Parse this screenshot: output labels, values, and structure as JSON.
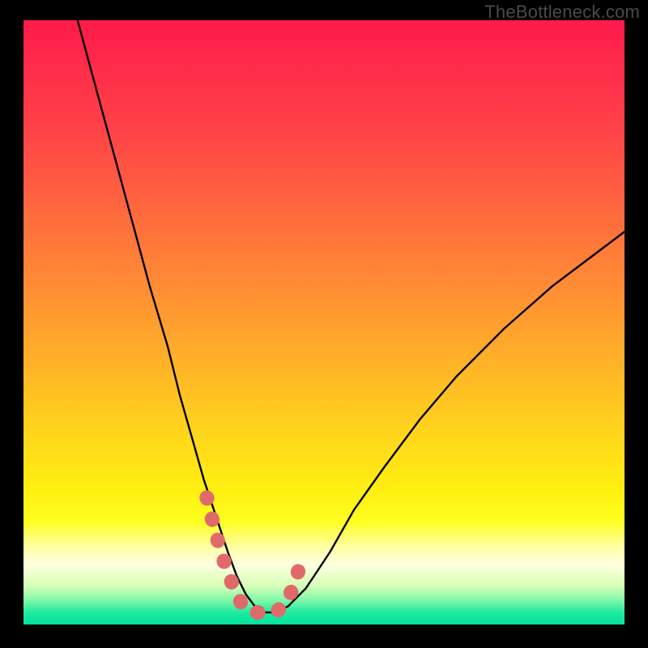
{
  "attribution": "TheBottleneck.com",
  "colors": {
    "background": "#000000",
    "curve": "#000000",
    "accent_dots": "#e06a6a",
    "gradient_top": "#ff1a4a",
    "gradient_bottom": "#00e29c"
  },
  "chart_data": {
    "type": "line",
    "title": "",
    "xlabel": "",
    "ylabel": "",
    "xlim": [
      0,
      100
    ],
    "ylim": [
      0,
      100
    ],
    "note": "Axes are unlabeled; x/y values estimated as percentage of plot area (0,0 = bottom-left). Curve shows a bottleneck V shape on a red-to-green vertical gradient.",
    "series": [
      {
        "name": "bottleneck-curve",
        "x": [
          9,
          12,
          15,
          18,
          21,
          24,
          26,
          28,
          30,
          32,
          34,
          35.5,
          37,
          38.5,
          40,
          42,
          44,
          47,
          51,
          55,
          60,
          66,
          72,
          80,
          88,
          96,
          100
        ],
        "y": [
          100,
          89,
          78,
          67,
          56,
          46,
          38,
          31,
          24,
          18,
          12,
          8,
          5,
          3,
          2,
          2,
          3,
          6,
          12,
          19,
          26,
          34,
          41,
          49,
          56,
          62,
          65
        ]
      }
    ],
    "annotations": {
      "name": "accent-segment",
      "description": "Thick salmon rounded marks near the curve bottom",
      "points_x": [
        30.5,
        32,
        33.5,
        35,
        36.5,
        38,
        40,
        42,
        44,
        45.5,
        46.5
      ],
      "points_y": [
        21,
        15,
        10,
        6,
        3,
        2,
        2,
        2,
        4,
        8,
        12
      ]
    }
  }
}
